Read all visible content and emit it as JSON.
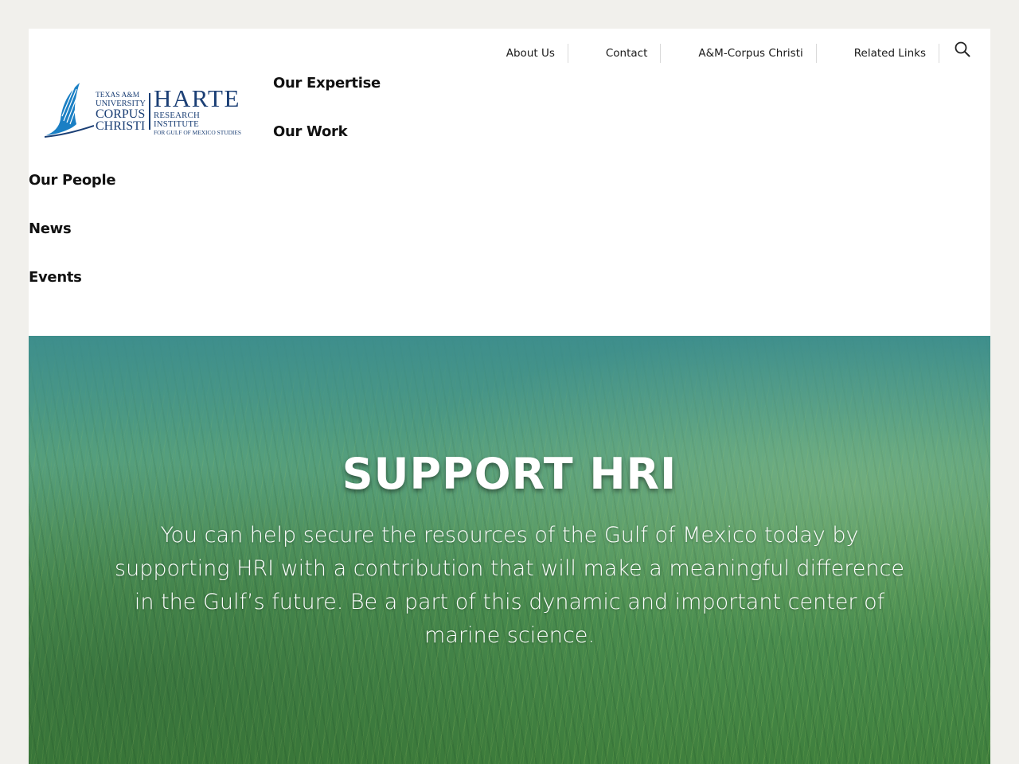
{
  "utility_nav": {
    "items": [
      {
        "label": "About Us"
      },
      {
        "label": "Contact"
      },
      {
        "label": "A&M-Corpus Christi"
      },
      {
        "label": "Related Links"
      }
    ],
    "search_icon": "search-icon"
  },
  "logo": {
    "university_line1": "TEXAS A&M",
    "university_line2": "UNIVERSITY",
    "university_line3": "CORPUS",
    "university_line4": "CHRISTI",
    "institute_name": "HARTE",
    "institute_line2": "RESEARCH INSTITUTE",
    "institute_line3": "FOR GULF OF MEXICO STUDIES",
    "brand_color": "#1b3f75",
    "mark_color": "#1a7fc4"
  },
  "main_nav": {
    "items": [
      {
        "label": "Our Expertise"
      },
      {
        "label": "Our Work"
      },
      {
        "label": "Our People"
      },
      {
        "label": "News"
      },
      {
        "label": "Events"
      }
    ]
  },
  "hero": {
    "title": "SUPPORT HRI",
    "body": "You can help secure the resources of the Gulf of Mexico today by supporting HRI with a contribution that will make a meaningful difference in the Gulf’s future. Be a part of this dynamic and important center of marine science."
  }
}
